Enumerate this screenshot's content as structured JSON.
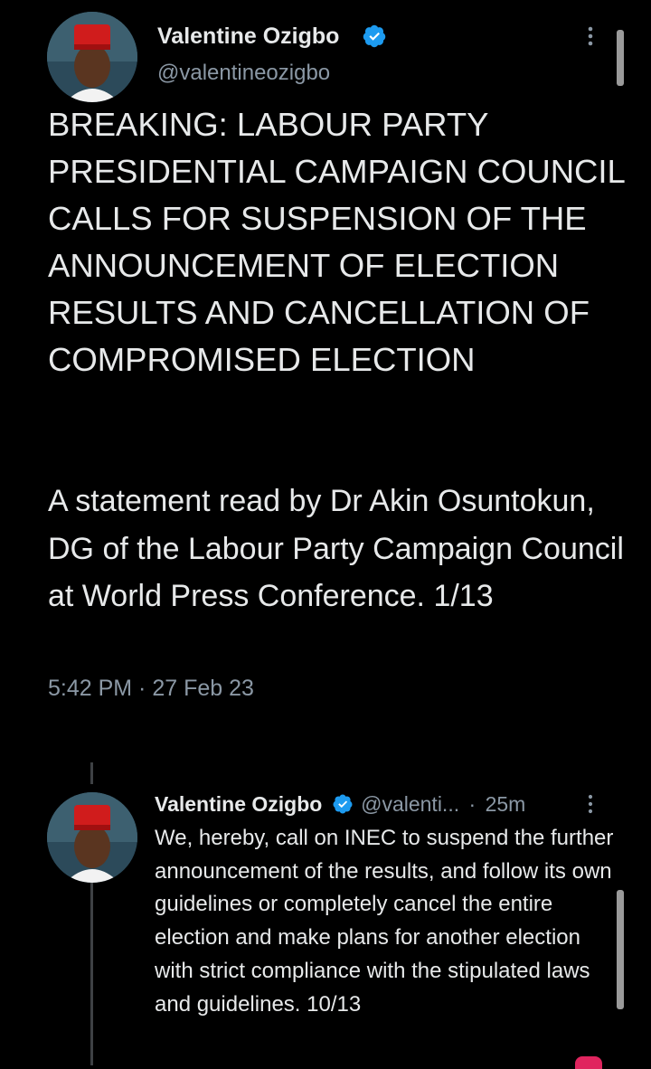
{
  "main_tweet": {
    "author_name": "Valentine Ozigbo",
    "handle": "@valentineozigbo",
    "headline": "BREAKING: LABOUR PARTY PRESIDENTIAL CAMPAIGN COUNCIL CALLS FOR SUSPENSION OF THE ANNOUNCEMENT OF ELECTION RESULTS AND CANCELLATION OF COMPROMISED ELECTION",
    "body": "A statement read by Dr Akin Osuntokun, DG of the Labour Party Campaign Council at World Press Conference. 1/13",
    "timestamp": "5:42 PM · 27 Feb 23"
  },
  "reply_tweet": {
    "author_name": "Valentine Ozigbo",
    "handle_short": "@valenti...",
    "separator": "·",
    "age": "25m",
    "text": "We, hereby, call on INEC to suspend the further announcement of the results, and follow its own guidelines or completely cancel the entire election and make plans for another election with strict compliance with the stipulated laws and guidelines. 10/13"
  },
  "icons": {
    "verified": "verified-badge-icon",
    "more": "more-vertical-icon"
  },
  "colors": {
    "background": "#000000",
    "text": "#e7e9ea",
    "secondary_text": "#8b98a5",
    "verified_blue": "#1d9bf0"
  }
}
